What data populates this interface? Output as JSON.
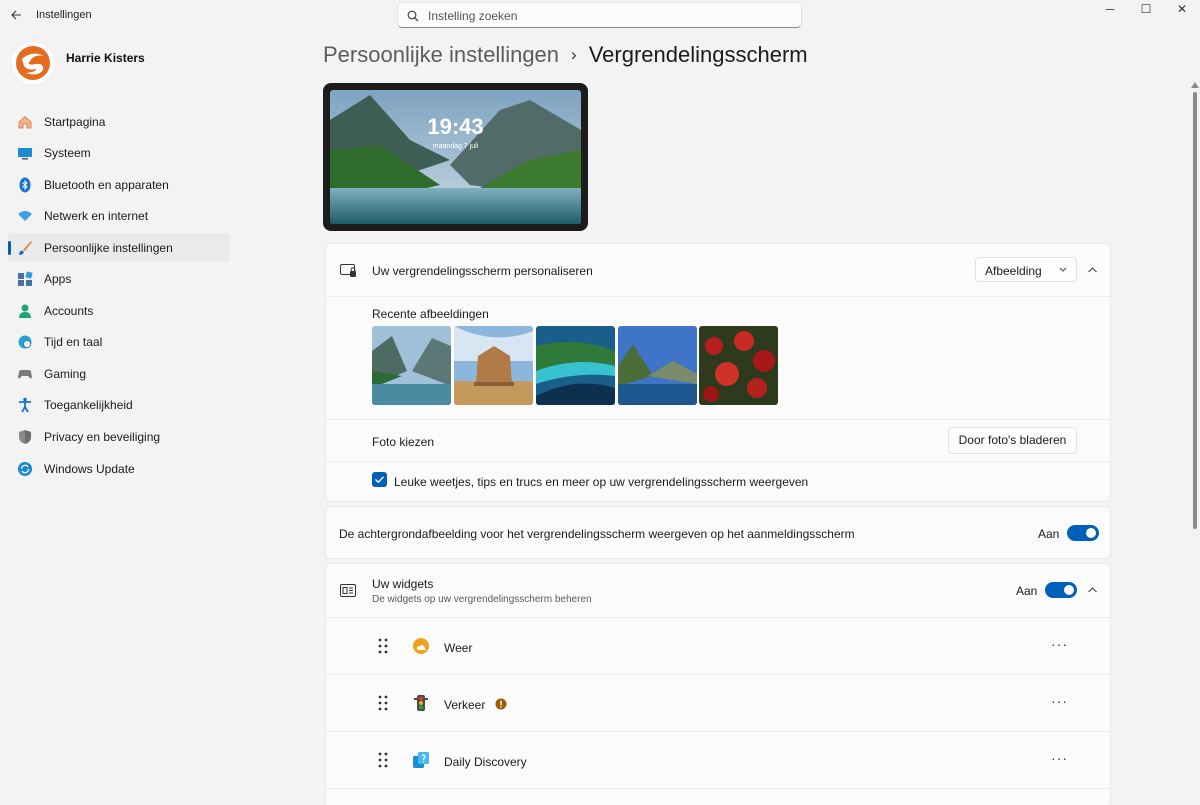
{
  "window": {
    "title": "Instellingen",
    "back_icon": "back-arrow-icon",
    "minimize": "─",
    "maximize": "☐",
    "close": "✕"
  },
  "search": {
    "placeholder": "Instelling zoeken"
  },
  "profile": {
    "name": "Harrie Kisters"
  },
  "sidebar": {
    "items": [
      {
        "label": "Startpagina",
        "icon": "home-icon"
      },
      {
        "label": "Systeem",
        "icon": "system-icon"
      },
      {
        "label": "Bluetooth en apparaten",
        "icon": "bluetooth-icon"
      },
      {
        "label": "Netwerk en internet",
        "icon": "wifi-icon"
      },
      {
        "label": "Persoonlijke instellingen",
        "icon": "brush-icon",
        "active": true
      },
      {
        "label": "Apps",
        "icon": "apps-icon"
      },
      {
        "label": "Accounts",
        "icon": "account-icon"
      },
      {
        "label": "Tijd en taal",
        "icon": "clock-globe-icon"
      },
      {
        "label": "Gaming",
        "icon": "gamepad-icon"
      },
      {
        "label": "Toegankelijkheid",
        "icon": "accessibility-icon"
      },
      {
        "label": "Privacy en beveiliging",
        "icon": "shield-icon"
      },
      {
        "label": "Windows Update",
        "icon": "update-icon"
      }
    ]
  },
  "breadcrumb": {
    "parent": "Persoonlijke instellingen",
    "separator": "›",
    "current": "Vergrendelingsscherm"
  },
  "preview": {
    "time": "19:43",
    "date": "maandag 7 juli"
  },
  "personalize": {
    "label": "Uw vergrendelingsscherm personaliseren",
    "dropdown_value": "Afbeelding",
    "recent_label": "Recente afbeeldingen",
    "recent_images": [
      "mountain-lake",
      "ancient-temple",
      "tropical-coast",
      "coastal-mountains",
      "red-flowers"
    ],
    "photo_label": "Foto kiezen",
    "browse_button": "Door foto's bladeren",
    "tips_label": "Leuke weetjes, tips en trucs en meer op uw vergrendelingsscherm weergeven",
    "tips_checked": true
  },
  "signin_bg": {
    "label": "De achtergrondafbeelding voor het vergrendelingsscherm weergeven op het aanmeldingsscherm",
    "state": "Aan",
    "on": true
  },
  "widgets": {
    "title": "Uw widgets",
    "subtitle": "De widgets op uw vergrendelingsscherm beheren",
    "state": "Aan",
    "on": true,
    "items": [
      {
        "label": "Weer",
        "icon": "weather-icon",
        "warning": false
      },
      {
        "label": "Verkeer",
        "icon": "traffic-light-icon",
        "warning": true
      },
      {
        "label": "Daily Discovery",
        "icon": "daily-discovery-icon",
        "warning": false
      }
    ],
    "more": "···"
  },
  "colors": {
    "accent": "#005fb8",
    "background": "#f3f3f3",
    "card": "#fbfbfb"
  }
}
